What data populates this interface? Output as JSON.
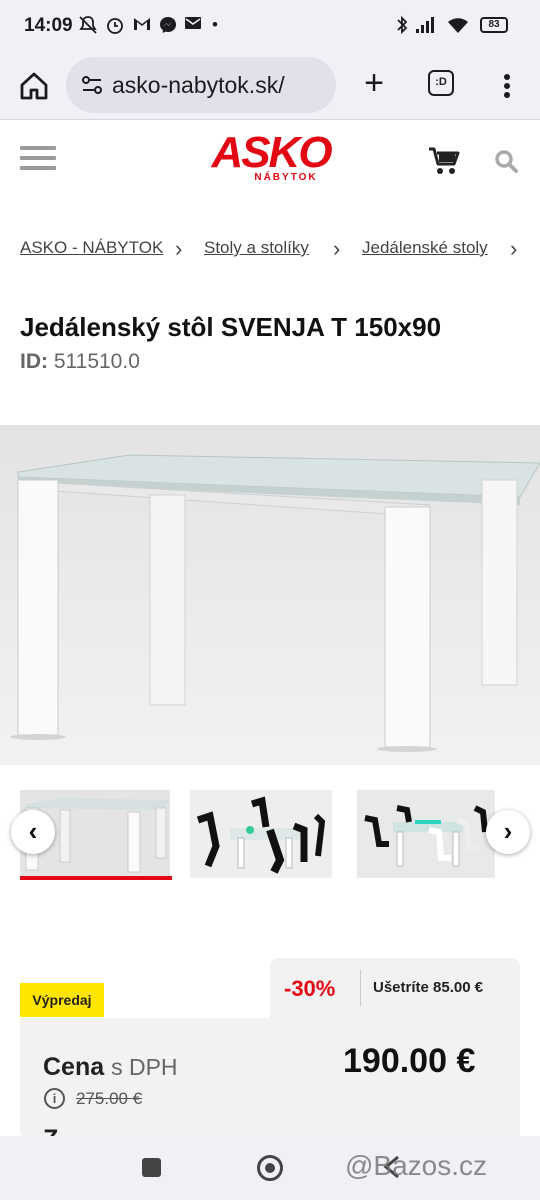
{
  "status_bar": {
    "time": "14:09",
    "battery": "83",
    "notification_icons": [
      "mute-icon",
      "alarm-icon",
      "gmail-icon",
      "messenger-icon",
      "mail-icon"
    ],
    "system_icons": [
      "bluetooth-icon",
      "signal-icon",
      "wifi-icon",
      "battery-icon"
    ]
  },
  "browser": {
    "url": "asko-nabytok.sk/",
    "tabs_label": ":D",
    "icons": [
      "home-icon",
      "site-settings-icon",
      "new-tab-icon",
      "tabs-icon",
      "overflow-menu-icon"
    ]
  },
  "header": {
    "logo_text": "ASKO",
    "logo_subtext": "NÁBYTOK",
    "icons": [
      "hamburger-icon",
      "cart-icon",
      "search-icon"
    ]
  },
  "breadcrumb": {
    "items": [
      "ASKO - NÁBYTOK",
      "Stoly a stolíky",
      "Jedálenské stoly"
    ],
    "separator": "›"
  },
  "product": {
    "title": "Jedálenský stôl SVENJA T 150x90",
    "id_label": "ID:",
    "id_value": "511510.0"
  },
  "gallery": {
    "prev_label": "‹",
    "next_label": "›",
    "thumbnail_count": 3,
    "active_thumbnail": 1
  },
  "pricing": {
    "badge": "Výpredaj",
    "discount": "-30%",
    "savings": "Ušetríte 85.00 €",
    "price_label": "Cena",
    "price_vat": "s DPH",
    "price": "190.00 €",
    "old_price": "275.00 €",
    "cut_text": "Z"
  },
  "watermark": "@Bazos.cz",
  "colors": {
    "brand_red": "#e30613",
    "badge_yellow": "#ffe500",
    "panel_gray": "#f2f2f2"
  }
}
